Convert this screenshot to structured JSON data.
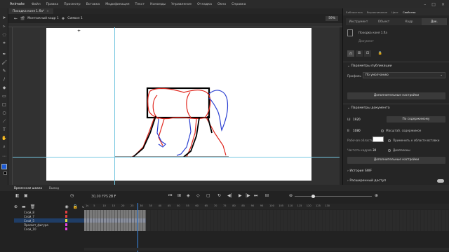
{
  "app": {
    "name": "Animate"
  },
  "menu": [
    "Файл",
    "Правка",
    "Просмотр",
    "Вставка",
    "Модификация",
    "Текст",
    "Команды",
    "Управление",
    "Отладка",
    "Окно",
    "Справка"
  ],
  "doc_tab": {
    "title": "Походка коня 1.fla*",
    "close": "×"
  },
  "scene": {
    "crumb1": "Монтажный кадр 1",
    "crumb2": "Символ 1",
    "zoom": "59%"
  },
  "right_panel": {
    "tabs": [
      "Библиотека",
      "Выравнивание",
      "Цвет",
      "Свойства"
    ],
    "active_tab": "Свойства",
    "subtabs": [
      "Инструмент",
      "Объект",
      "Кадр",
      "Док."
    ],
    "active_subtab": "Док.",
    "doc_name": "Походка коня 1.fla",
    "doc_label": "Документ",
    "publish_section": "Параметры публикации",
    "profile_label": "Профиль",
    "profile_value": "По умолчанию",
    "more_settings": "Дополнительные настройки",
    "doc_section": "Параметры документа",
    "width_label": "Ш",
    "width": "1920",
    "height_label": "В",
    "height": "1080",
    "fit_btn": "По содержимому",
    "scale_content": "Масштаб. содержимое",
    "apply_paste": "Применить к области вставки",
    "stage_label": "Рабочая область",
    "stage_color": "#ffffff",
    "ranges": "Диапазоны",
    "fps_label": "Частота кадров",
    "fps": "30",
    "more_settings2": "Дополнительные настройки",
    "swf_history": "История SWF",
    "ext_access": "Расширенный доступ"
  },
  "timeline": {
    "tabs": [
      "Временная шкала",
      "Вывод"
    ],
    "fps": "30,00",
    "fps_unit": "FPS",
    "current_frame": "28",
    "frame_suffix": "F",
    "ruler": [
      "1s",
      "5",
      "10",
      "15",
      "20",
      "25",
      "30",
      "35",
      "40",
      "45",
      "50",
      "55",
      "60",
      "65",
      "70",
      "75",
      "80",
      "85",
      "90",
      "95",
      "100",
      "105",
      "110",
      "115",
      "120",
      "125",
      "130"
    ],
    "layers": [
      {
        "name": "Слой_8",
        "color": "#e04040"
      },
      {
        "name": "Слой_7",
        "color": "#e04040"
      },
      {
        "name": "Слой_5",
        "color": "#e0e040"
      },
      {
        "name": "Просвет_фигура",
        "color": "#e040e0"
      },
      {
        "name": "Слой_10",
        "color": "#e040e0"
      }
    ]
  },
  "colors": {
    "accent": "#3b8bea",
    "horse_body": "#e0251c",
    "horse_legs": "#2a3fd1",
    "outline": "#000000"
  }
}
